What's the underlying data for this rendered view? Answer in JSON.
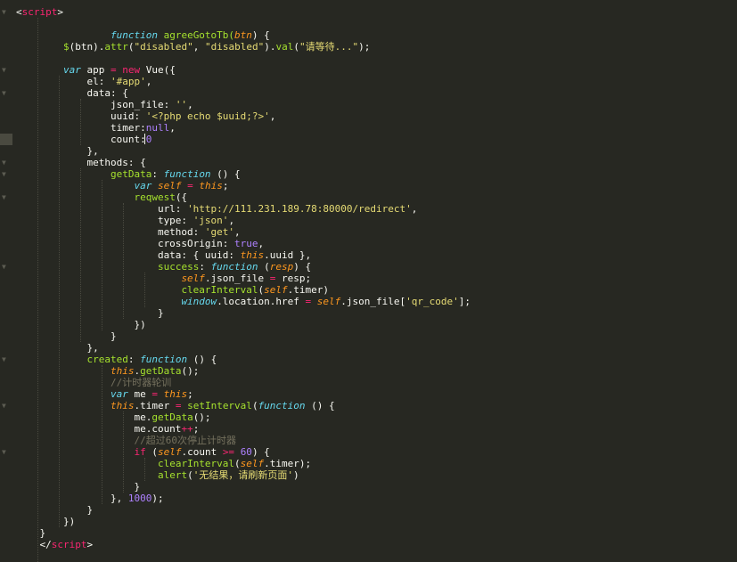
{
  "editor": {
    "lines": [
      [
        [
          "<",
          "t-br"
        ],
        [
          "script",
          "t-tag"
        ],
        [
          ">",
          "t-br"
        ]
      ],
      [],
      [
        [
          "                ",
          ""
        ],
        [
          "function",
          "t-kw"
        ],
        [
          " agreeGotoTb(",
          "t-fn"
        ],
        [
          "btn",
          "t-arg"
        ],
        [
          ") {",
          "t-plain"
        ]
      ],
      [
        [
          "        ",
          ""
        ],
        [
          "$",
          "t-fn"
        ],
        [
          "(btn).",
          "t-plain"
        ],
        [
          "attr",
          "t-fn"
        ],
        [
          "(",
          "t-plain"
        ],
        [
          "\"disabled\"",
          "t-str"
        ],
        [
          ", ",
          "t-plain"
        ],
        [
          "\"disabled\"",
          "t-str"
        ],
        [
          ").",
          "t-plain"
        ],
        [
          "val",
          "t-fn"
        ],
        [
          "(",
          "t-plain"
        ],
        [
          "\"请等待...\"",
          "t-str"
        ],
        [
          ");",
          "t-plain"
        ]
      ],
      [],
      [
        [
          "        ",
          ""
        ],
        [
          "var",
          "t-kw"
        ],
        [
          " app ",
          "t-plain"
        ],
        [
          "=",
          "t-op"
        ],
        [
          " ",
          "t-plain"
        ],
        [
          "new",
          "t-op"
        ],
        [
          " Vue({",
          "t-plain"
        ]
      ],
      [
        [
          "            el: ",
          "t-plain"
        ],
        [
          "'#app'",
          "t-str"
        ],
        [
          ",",
          "t-plain"
        ]
      ],
      [
        [
          "            data: {",
          "t-plain"
        ]
      ],
      [
        [
          "                json_file: ",
          "t-plain"
        ],
        [
          "''",
          "t-str"
        ],
        [
          ",",
          "t-plain"
        ]
      ],
      [
        [
          "                uuid: ",
          "t-plain"
        ],
        [
          "'<?php echo $uuid;?>'",
          "t-str"
        ],
        [
          ",",
          "t-plain"
        ]
      ],
      [
        [
          "                timer:",
          "t-plain"
        ],
        [
          "null",
          "t-num"
        ],
        [
          ",",
          "t-plain"
        ]
      ],
      [
        [
          "                count:",
          "t-plain"
        ],
        [
          "0",
          "t-num"
        ],
        [
          " ",
          "t-plain"
        ]
      ],
      [
        [
          "            },",
          "t-plain"
        ]
      ],
      [
        [
          "            methods: {",
          "t-plain"
        ]
      ],
      [
        [
          "                ",
          ""
        ],
        [
          "getData",
          "t-fn"
        ],
        [
          ": ",
          "t-plain"
        ],
        [
          "function",
          "t-kw"
        ],
        [
          " () {",
          "t-plain"
        ]
      ],
      [
        [
          "                    ",
          ""
        ],
        [
          "var",
          "t-kw"
        ],
        [
          " ",
          "t-plain"
        ],
        [
          "self",
          "t-this"
        ],
        [
          " ",
          "t-plain"
        ],
        [
          "=",
          "t-op"
        ],
        [
          " ",
          "t-plain"
        ],
        [
          "this",
          "t-this"
        ],
        [
          ";",
          "t-plain"
        ]
      ],
      [
        [
          "                    ",
          ""
        ],
        [
          "reqwest",
          "t-fn"
        ],
        [
          "({",
          "t-plain"
        ]
      ],
      [
        [
          "                        url: ",
          "t-plain"
        ],
        [
          "'http://111.231.189.78:80000/redirect'",
          "t-str"
        ],
        [
          ",",
          "t-plain"
        ]
      ],
      [
        [
          "                        type: ",
          "t-plain"
        ],
        [
          "'json'",
          "t-str"
        ],
        [
          ",",
          "t-plain"
        ]
      ],
      [
        [
          "                        method: ",
          "t-plain"
        ],
        [
          "'get'",
          "t-str"
        ],
        [
          ",",
          "t-plain"
        ]
      ],
      [
        [
          "                        crossOrigin: ",
          "t-plain"
        ],
        [
          "true",
          "t-num"
        ],
        [
          ",",
          "t-plain"
        ]
      ],
      [
        [
          "                        data: { uuid: ",
          "t-plain"
        ],
        [
          "this",
          "t-this"
        ],
        [
          ".uuid },",
          "t-plain"
        ]
      ],
      [
        [
          "                        ",
          ""
        ],
        [
          "success",
          "t-fn"
        ],
        [
          ": ",
          "t-plain"
        ],
        [
          "function",
          "t-kw"
        ],
        [
          " (",
          "t-plain"
        ],
        [
          "resp",
          "t-arg"
        ],
        [
          ") {",
          "t-plain"
        ]
      ],
      [
        [
          "                            ",
          ""
        ],
        [
          "self",
          "t-this"
        ],
        [
          ".json_file ",
          "t-plain"
        ],
        [
          "=",
          "t-op"
        ],
        [
          " resp;",
          "t-plain"
        ]
      ],
      [
        [
          "                            ",
          ""
        ],
        [
          "clearInterval",
          "t-kw2"
        ],
        [
          "(",
          "t-plain"
        ],
        [
          "self",
          "t-this"
        ],
        [
          ".timer)",
          "t-plain"
        ]
      ],
      [
        [
          "                            ",
          ""
        ],
        [
          "window",
          "t-kw"
        ],
        [
          ".location.href ",
          "t-plain"
        ],
        [
          "=",
          "t-op"
        ],
        [
          " ",
          "t-plain"
        ],
        [
          "self",
          "t-this"
        ],
        [
          ".json_file[",
          "t-plain"
        ],
        [
          "'qr_code'",
          "t-str"
        ],
        [
          "];",
          "t-plain"
        ]
      ],
      [
        [
          "                        }",
          "t-plain"
        ]
      ],
      [
        [
          "                    })",
          "t-plain"
        ]
      ],
      [
        [
          "                }",
          "t-plain"
        ]
      ],
      [
        [
          "            },",
          "t-plain"
        ]
      ],
      [
        [
          "            ",
          ""
        ],
        [
          "created",
          "t-fn"
        ],
        [
          ": ",
          "t-plain"
        ],
        [
          "function",
          "t-kw"
        ],
        [
          " () {",
          "t-plain"
        ]
      ],
      [
        [
          "                ",
          ""
        ],
        [
          "this",
          "t-this"
        ],
        [
          ".",
          "t-plain"
        ],
        [
          "getData",
          "t-fn"
        ],
        [
          "();",
          "t-plain"
        ]
      ],
      [
        [
          "                ",
          ""
        ],
        [
          "//计时器轮训",
          "t-cm"
        ]
      ],
      [
        [
          "                ",
          ""
        ],
        [
          "var",
          "t-kw"
        ],
        [
          " me ",
          "t-plain"
        ],
        [
          "=",
          "t-op"
        ],
        [
          " ",
          "t-plain"
        ],
        [
          "this",
          "t-this"
        ],
        [
          ";",
          "t-plain"
        ]
      ],
      [
        [
          "                ",
          ""
        ],
        [
          "this",
          "t-this"
        ],
        [
          ".timer ",
          "t-plain"
        ],
        [
          "=",
          "t-op"
        ],
        [
          " ",
          "t-plain"
        ],
        [
          "setInterval",
          "t-kw2"
        ],
        [
          "(",
          "t-plain"
        ],
        [
          "function",
          "t-kw"
        ],
        [
          " () {",
          "t-plain"
        ]
      ],
      [
        [
          "                    me.",
          "t-plain"
        ],
        [
          "getData",
          "t-fn"
        ],
        [
          "();",
          "t-plain"
        ]
      ],
      [
        [
          "                    me.count",
          "t-plain"
        ],
        [
          "++",
          "t-op"
        ],
        [
          ";",
          "t-plain"
        ]
      ],
      [
        [
          "                    ",
          ""
        ],
        [
          "//超过60次停止计时器",
          "t-cm"
        ]
      ],
      [
        [
          "                    ",
          ""
        ],
        [
          "if",
          "t-ctl"
        ],
        [
          " (",
          "t-plain"
        ],
        [
          "self",
          "t-this"
        ],
        [
          ".count ",
          "t-plain"
        ],
        [
          ">=",
          "t-op"
        ],
        [
          " ",
          "t-plain"
        ],
        [
          "60",
          "t-num"
        ],
        [
          ") {",
          "t-plain"
        ]
      ],
      [
        [
          "                        ",
          ""
        ],
        [
          "clearInterval",
          "t-kw2"
        ],
        [
          "(",
          "t-plain"
        ],
        [
          "self",
          "t-this"
        ],
        [
          ".timer);",
          "t-plain"
        ]
      ],
      [
        [
          "                        ",
          ""
        ],
        [
          "alert",
          "t-kw2"
        ],
        [
          "(",
          "t-plain"
        ],
        [
          "'无结果，请刷新页面'",
          "t-str"
        ],
        [
          ")",
          "t-plain"
        ]
      ],
      [
        [
          "                    }",
          "t-plain"
        ]
      ],
      [
        [
          "                }, ",
          "t-plain"
        ],
        [
          "1000",
          "t-num"
        ],
        [
          ");",
          "t-plain"
        ]
      ],
      [
        [
          "            }",
          "t-plain"
        ]
      ],
      [
        [
          "        })",
          "t-plain"
        ]
      ],
      [
        [
          "    }",
          "t-plain"
        ]
      ],
      [
        [
          "    ",
          ""
        ],
        [
          "</",
          "t-br"
        ],
        [
          "script",
          "t-tag"
        ],
        [
          ">",
          "t-br"
        ]
      ]
    ]
  }
}
